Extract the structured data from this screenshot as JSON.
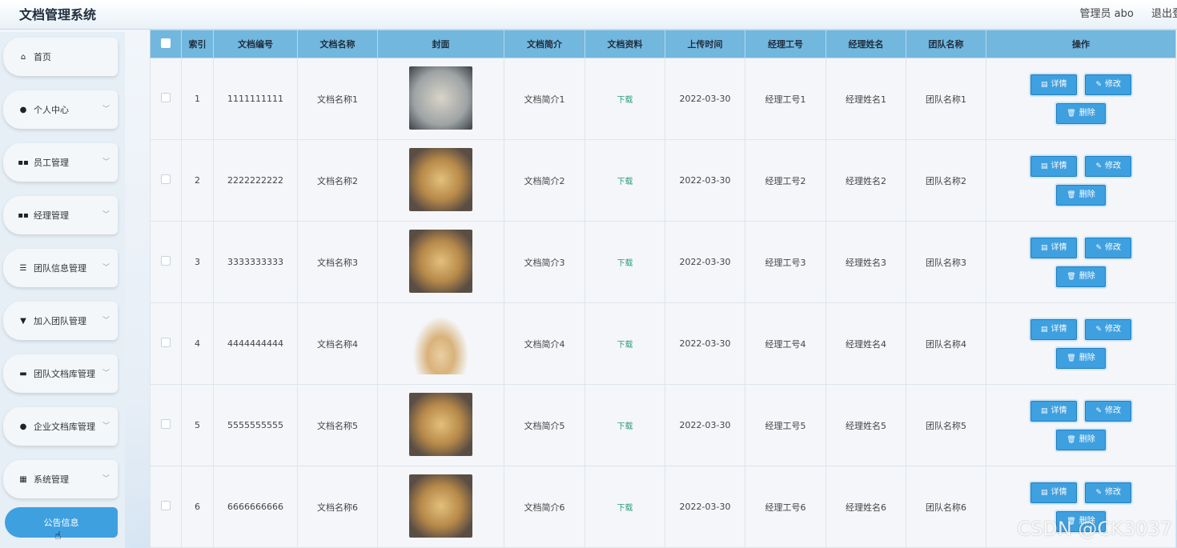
{
  "header": {
    "title": "文档管理系统",
    "user": "管理员 abo",
    "logout": "退出登录"
  },
  "sidebar": {
    "items": [
      {
        "label": "首页",
        "icon": "home-icon",
        "glyph": "⌂",
        "chevron": false
      },
      {
        "label": "个人中心",
        "icon": "person-icon",
        "glyph": "●",
        "chevron": true
      },
      {
        "label": "员工管理",
        "icon": "grid-icon",
        "glyph": "▪▪",
        "chevron": true
      },
      {
        "label": "经理管理",
        "icon": "grid-icon",
        "glyph": "▪▪",
        "chevron": true
      },
      {
        "label": "团队信息管理",
        "icon": "sliders-icon",
        "glyph": "☰",
        "chevron": true
      },
      {
        "label": "加入团队管理",
        "icon": "flag-icon",
        "glyph": "▼",
        "chevron": true
      },
      {
        "label": "团队文档库管理",
        "icon": "ticket-icon",
        "glyph": "▬",
        "chevron": true
      },
      {
        "label": "企业文档库管理",
        "icon": "user-icon",
        "glyph": "●",
        "chevron": true
      },
      {
        "label": "系统管理",
        "icon": "apps-icon",
        "glyph": "▦",
        "chevron": true
      }
    ],
    "notice": "公告信息"
  },
  "table": {
    "headers": [
      "索引",
      "文档编号",
      "文档名称",
      "封面",
      "文档简介",
      "文档资料",
      "上传时间",
      "经理工号",
      "经理姓名",
      "团队名称",
      "操作"
    ],
    "rows": [
      {
        "index": "1",
        "code": "1111111111",
        "name": "文档名称1",
        "cover": "open",
        "intro": "文档简介1",
        "file": "下载",
        "time": "2022-03-30",
        "mgr_no": "经理工号1",
        "mgr_name": "经理姓名1",
        "team": "团队名称1"
      },
      {
        "index": "2",
        "code": "2222222222",
        "name": "文档名称2",
        "cover": "brown",
        "intro": "文档简介2",
        "file": "下载",
        "time": "2022-03-30",
        "mgr_no": "经理工号2",
        "mgr_name": "经理姓名2",
        "team": "团队名称2"
      },
      {
        "index": "3",
        "code": "3333333333",
        "name": "文档名称3",
        "cover": "brown",
        "intro": "文档简介3",
        "file": "下载",
        "time": "2022-03-30",
        "mgr_no": "经理工号3",
        "mgr_name": "经理姓名3",
        "team": "团队名称3"
      },
      {
        "index": "4",
        "code": "4444444444",
        "name": "文档名称4",
        "cover": "fan",
        "intro": "文档简介4",
        "file": "下载",
        "time": "2022-03-30",
        "mgr_no": "经理工号4",
        "mgr_name": "经理姓名4",
        "team": "团队名称4"
      },
      {
        "index": "5",
        "code": "5555555555",
        "name": "文档名称5",
        "cover": "brown",
        "intro": "文档简介5",
        "file": "下载",
        "time": "2022-03-30",
        "mgr_no": "经理工号5",
        "mgr_name": "经理姓名5",
        "team": "团队名称5"
      },
      {
        "index": "6",
        "code": "6666666666",
        "name": "文档名称6",
        "cover": "brown",
        "intro": "文档简介6",
        "file": "下载",
        "time": "2022-03-30",
        "mgr_no": "经理工号6",
        "mgr_name": "经理姓名6",
        "team": "团队名称6"
      }
    ],
    "actions": {
      "detail": "详情",
      "edit": "修改",
      "delete": "删除"
    }
  },
  "watermark": "CSDN @CK3037",
  "colors": {
    "accent": "#3fa0e0",
    "header_row": "#72b7de",
    "download": "#2a9d7a"
  }
}
